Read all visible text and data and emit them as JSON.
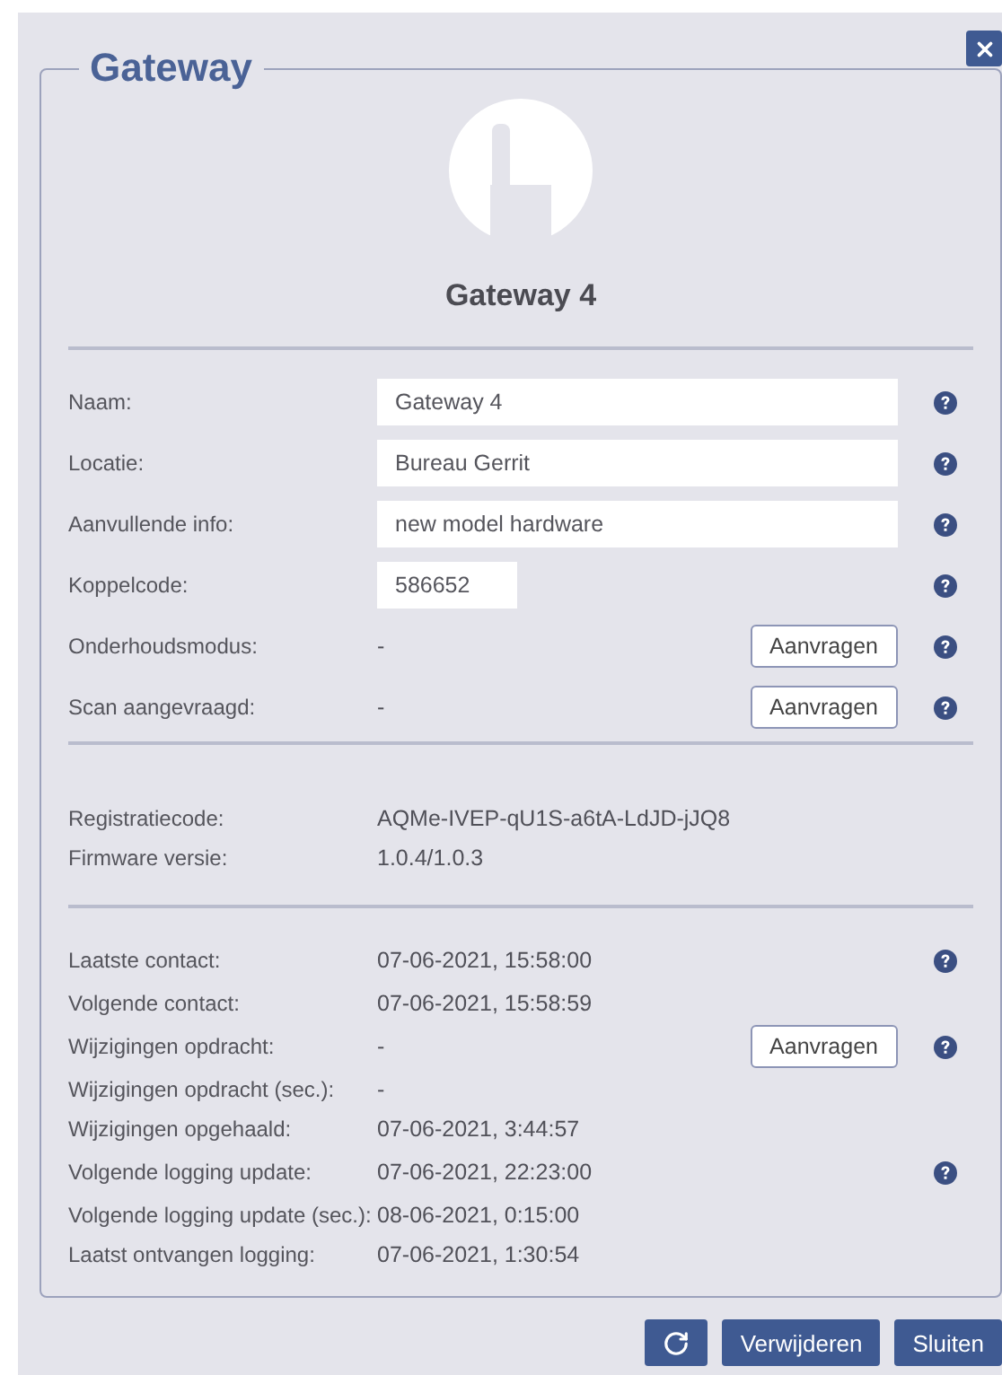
{
  "dialog": {
    "title": "Gateway",
    "device_name": "Gateway 4"
  },
  "sections": [
    {
      "kind": "form",
      "rows": [
        {
          "label": "Naam:",
          "kind": "input",
          "value": "Gateway 4",
          "help": true
        },
        {
          "label": "Locatie:",
          "kind": "input",
          "value": "Bureau Gerrit",
          "help": true
        },
        {
          "label": "Aanvullende info:",
          "kind": "input",
          "value": "new model hardware",
          "help": true
        },
        {
          "label": "Koppelcode:",
          "kind": "short-input",
          "value": "586652",
          "help": true
        },
        {
          "label": "Onderhoudsmodus:",
          "kind": "text",
          "value": "-",
          "button": "Aanvragen",
          "help": true
        },
        {
          "label": "Scan aangevraagd:",
          "kind": "text",
          "value": "-",
          "button": "Aanvragen",
          "help": true
        }
      ]
    },
    {
      "kind": "info",
      "rows": [
        {
          "label": "Registratiecode:",
          "kind": "text",
          "value": "AQMe-IVEP-qU1S-a6tA-LdJD-jJQ8",
          "help": false
        },
        {
          "label": "Firmware versie:",
          "kind": "text",
          "value": "1.0.4/1.0.3",
          "help": false
        }
      ]
    },
    {
      "kind": "status",
      "rows": [
        {
          "label": "Laatste contact:",
          "kind": "text",
          "value": "07-06-2021, 15:58:00",
          "help": true
        },
        {
          "label": "Volgende contact:",
          "kind": "text",
          "value": "07-06-2021, 15:58:59",
          "help": false
        },
        {
          "label": "Wijzigingen opdracht:",
          "kind": "text",
          "value": "-",
          "button": "Aanvragen",
          "help": true
        },
        {
          "label": "Wijzigingen opdracht (sec.):",
          "kind": "text",
          "value": "-",
          "help": false
        },
        {
          "label": "Wijzigingen opgehaald:",
          "kind": "text",
          "value": "07-06-2021, 3:44:57",
          "help": false
        },
        {
          "label": "Volgende logging update:",
          "kind": "text",
          "value": "07-06-2021, 22:23:00",
          "help": true
        },
        {
          "label": "Volgende logging update (sec.):",
          "kind": "text",
          "value": "08-06-2021, 0:15:00",
          "help": false
        },
        {
          "label": "Laatst ontvangen logging:",
          "kind": "text",
          "value": "07-06-2021, 1:30:54",
          "help": false
        }
      ]
    }
  ],
  "footer_buttons": [
    {
      "kind": "refresh"
    },
    {
      "kind": "text",
      "label": "Verwijderen"
    },
    {
      "kind": "text",
      "label": "Sluiten"
    }
  ]
}
